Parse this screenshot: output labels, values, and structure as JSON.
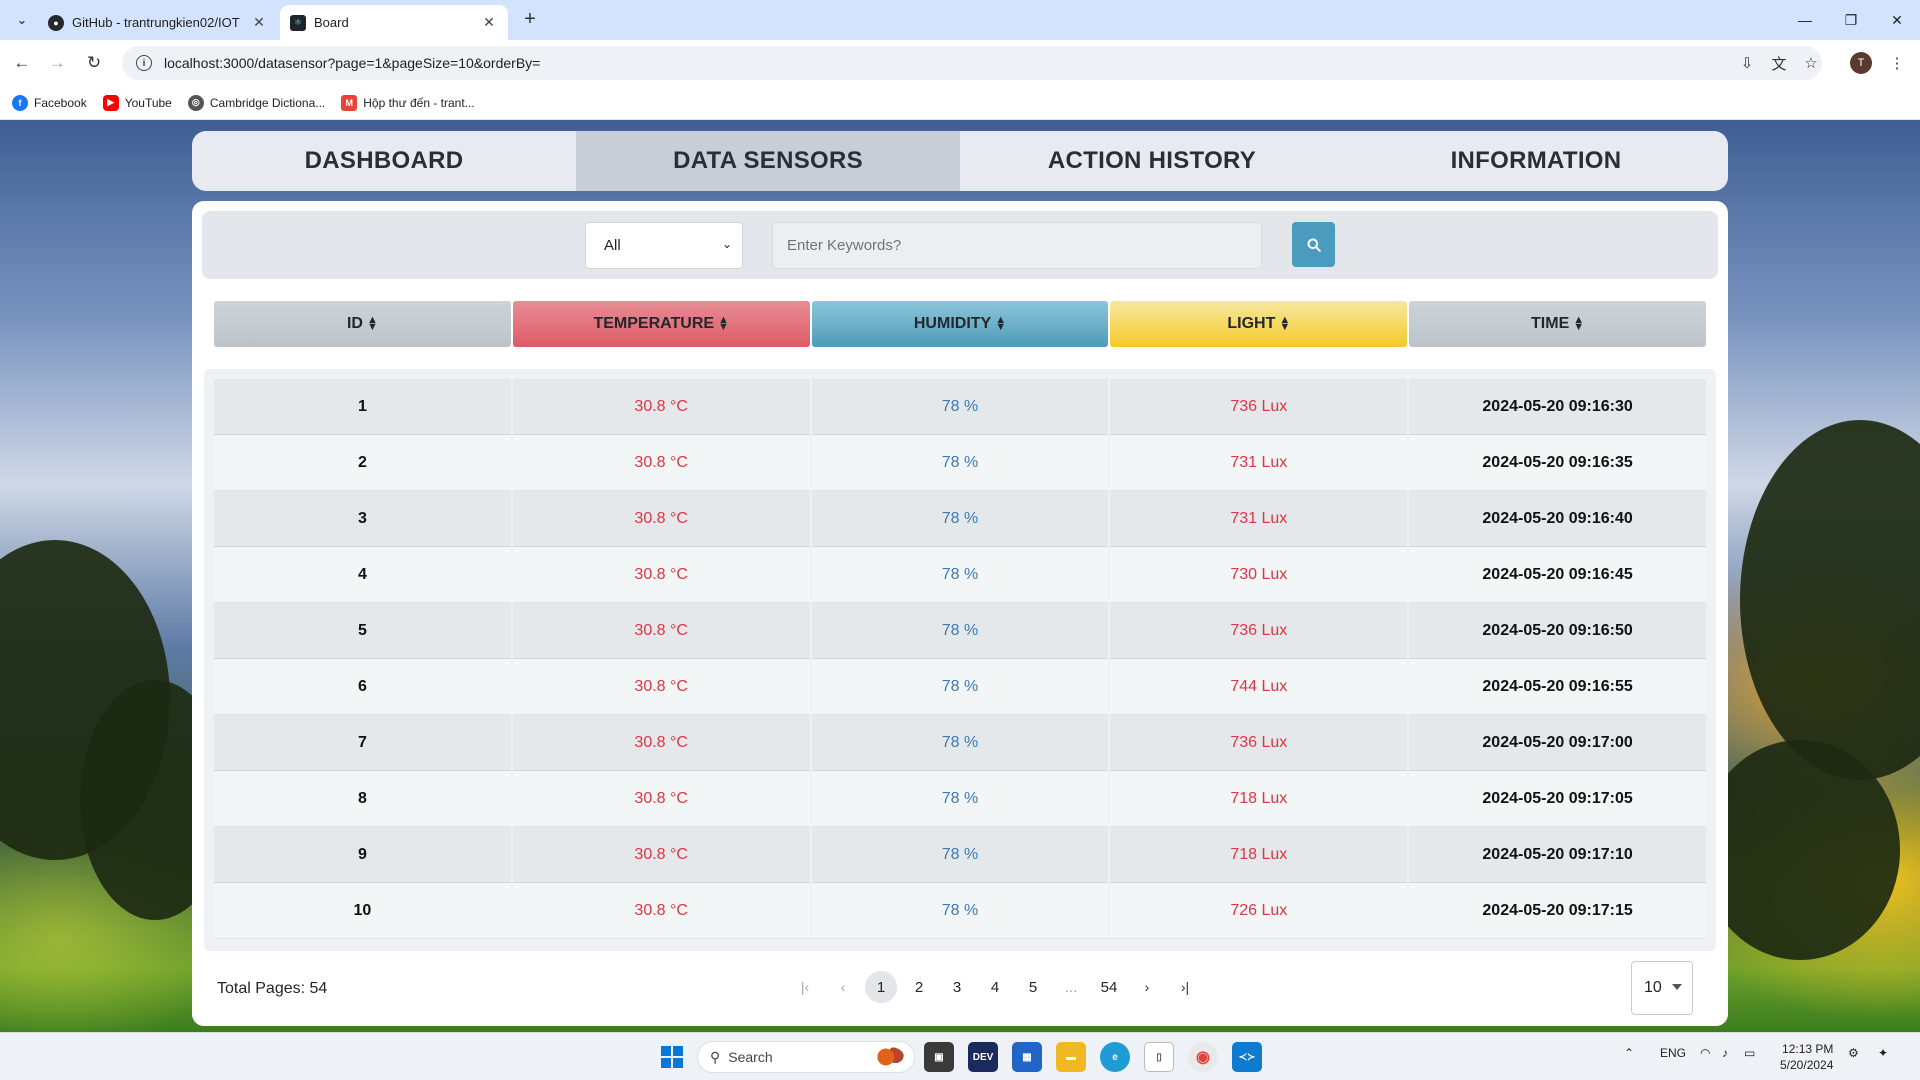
{
  "browser": {
    "tabs": [
      {
        "title": "GitHub - trantrungkien02/IOT",
        "active": false
      },
      {
        "title": "Board",
        "active": true
      }
    ],
    "url": "localhost:3000/datasensor?page=1&pageSize=10&orderBy=",
    "profile_initial": "T",
    "bookmarks": [
      {
        "label": "Facebook",
        "icon": "facebook-icon",
        "color": "#1877f2"
      },
      {
        "label": "YouTube",
        "icon": "youtube-icon",
        "color": "#ff0000"
      },
      {
        "label": "Cambridge Dictiona...",
        "icon": "globe-icon",
        "color": "#555555"
      },
      {
        "label": "Hộp thư đến - trant...",
        "icon": "gmail-icon",
        "color": "#ea4335"
      }
    ]
  },
  "nav": {
    "tabs": [
      "DASHBOARD",
      "DATA SENSORS",
      "ACTION HISTORY",
      "INFORMATION"
    ],
    "active_index": 1
  },
  "filter": {
    "selected": "All",
    "search_placeholder": "Enter Keywords?",
    "search_value": ""
  },
  "table": {
    "columns": [
      "ID",
      "TEMPERATURE",
      "HUMIDITY",
      "LIGHT",
      "TIME"
    ],
    "rows": [
      {
        "id": "1",
        "temperature": "30.8 °C",
        "humidity": "78 %",
        "light": "736 Lux",
        "time": "2024-05-20 09:16:30"
      },
      {
        "id": "2",
        "temperature": "30.8 °C",
        "humidity": "78 %",
        "light": "731 Lux",
        "time": "2024-05-20 09:16:35"
      },
      {
        "id": "3",
        "temperature": "30.8 °C",
        "humidity": "78 %",
        "light": "731 Lux",
        "time": "2024-05-20 09:16:40"
      },
      {
        "id": "4",
        "temperature": "30.8 °C",
        "humidity": "78 %",
        "light": "730 Lux",
        "time": "2024-05-20 09:16:45"
      },
      {
        "id": "5",
        "temperature": "30.8 °C",
        "humidity": "78 %",
        "light": "736 Lux",
        "time": "2024-05-20 09:16:50"
      },
      {
        "id": "6",
        "temperature": "30.8 °C",
        "humidity": "78 %",
        "light": "744 Lux",
        "time": "2024-05-20 09:16:55"
      },
      {
        "id": "7",
        "temperature": "30.8 °C",
        "humidity": "78 %",
        "light": "736 Lux",
        "time": "2024-05-20 09:17:00"
      },
      {
        "id": "8",
        "temperature": "30.8 °C",
        "humidity": "78 %",
        "light": "718 Lux",
        "time": "2024-05-20 09:17:05"
      },
      {
        "id": "9",
        "temperature": "30.8 °C",
        "humidity": "78 %",
        "light": "718 Lux",
        "time": "2024-05-20 09:17:10"
      },
      {
        "id": "10",
        "temperature": "30.8 °C",
        "humidity": "78 %",
        "light": "726 Lux",
        "time": "2024-05-20 09:17:15"
      }
    ]
  },
  "pagination": {
    "total_label": "Total Pages: 54",
    "pages": [
      "1",
      "2",
      "3",
      "4",
      "5",
      "...",
      "54"
    ],
    "current": "1",
    "page_size": "10"
  },
  "taskbar": {
    "search_label": "Search",
    "language": "ENG",
    "time": "12:13 PM",
    "date": "5/20/2024",
    "apps": [
      "file-explorer-icon",
      "dev-icon",
      "store-icon",
      "folder-icon",
      "edge-icon",
      "notepad-icon",
      "chrome-icon",
      "vscode-icon"
    ]
  },
  "colors": {
    "temperature_header": "#dd5b67",
    "humidity_header": "#4f9bb8",
    "light_header": "#f5c928",
    "temperature_text": "#dc3545",
    "humidity_text": "#3b7ab3",
    "search_button": "#4a9bbd"
  }
}
